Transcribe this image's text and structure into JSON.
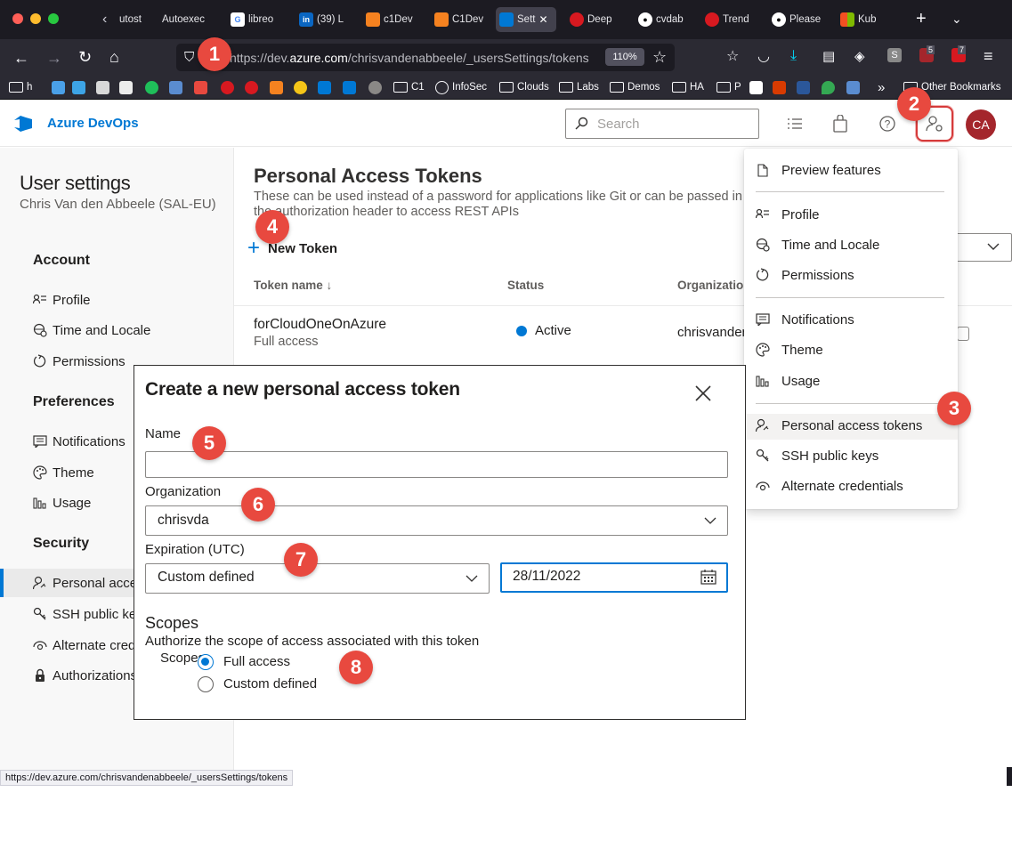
{
  "browser": {
    "tabs": [
      {
        "label": "utost"
      },
      {
        "label": "Autoexec"
      },
      {
        "label": "libreo"
      },
      {
        "label": "(39) L"
      },
      {
        "label": "c1Dev"
      },
      {
        "label": "C1Dev"
      },
      {
        "label": "Sett"
      },
      {
        "label": "Deep"
      },
      {
        "label": "cvdab"
      },
      {
        "label": "Trend"
      },
      {
        "label": "Please"
      },
      {
        "label": "Kub"
      }
    ],
    "url_prefix": "https://dev.",
    "url_domain": "azure.com",
    "url_path": "/chrisvandenabbeele/_usersSettings/tokens",
    "zoom": "110%",
    "bookmarks": [
      {
        "label": "h"
      },
      {
        "label": "C1"
      },
      {
        "label": "InfoSec"
      },
      {
        "label": "Clouds"
      },
      {
        "label": "Labs"
      },
      {
        "label": "Demos"
      },
      {
        "label": "HA"
      },
      {
        "label": "P"
      },
      {
        "label": "Other Bookmarks"
      }
    ],
    "badge_counts": [
      "5",
      "7"
    ],
    "status_url": "https://dev.azure.com/chrisvandenabbeele/_usersSettings/tokens"
  },
  "header": {
    "brand": "Azure DevOps",
    "search_placeholder": "Search",
    "avatar_initials": "CA"
  },
  "sidebar": {
    "title": "User settings",
    "subtitle": "Chris Van den Abbeele (SAL-EU)",
    "sections": {
      "account": "Account",
      "preferences": "Preferences",
      "security": "Security"
    },
    "items": {
      "profile": "Profile",
      "time_locale": "Time and Locale",
      "permissions": "Permissions",
      "notifications": "Notifications",
      "theme": "Theme",
      "usage": "Usage",
      "pat": "Personal access tokens",
      "ssh": "SSH public keys",
      "alternate": "Alternate credentials",
      "authorizations": "Authorizations"
    }
  },
  "main": {
    "title": "Personal Access Tokens",
    "description": "These can be used instead of a password for applications like Git or can be passed in the authorization header to access REST APIs",
    "new_token": "New Token",
    "columns": {
      "name": "Token name",
      "status": "Status",
      "org": "Organization"
    },
    "rows": [
      {
        "name": "forCloudOneOnAzure",
        "scope": "Full access",
        "status": "Active",
        "org": "chrisvandenabbeele"
      }
    ]
  },
  "menu": {
    "preview": "Preview features",
    "profile": "Profile",
    "time_locale": "Time and Locale",
    "permissions": "Permissions",
    "notifications": "Notifications",
    "theme": "Theme",
    "usage": "Usage",
    "pat": "Personal access tokens",
    "ssh": "SSH public keys",
    "alternate": "Alternate credentials"
  },
  "modal": {
    "title": "Create a new personal access token",
    "name_label": "Name",
    "name_value": "",
    "org_label": "Organization",
    "org_value": "chrisvda",
    "exp_label": "Expiration (UTC)",
    "exp_value": "Custom defined",
    "date_value": "28/11/2022",
    "scopes_heading": "Scopes",
    "scopes_desc": "Authorize the scope of access associated with this token",
    "scopes_label": "Scopes",
    "scope_full": "Full access",
    "scope_custom": "Custom defined",
    "scope_selected": "Full access"
  },
  "annotations": [
    "1",
    "2",
    "3",
    "4",
    "5",
    "6",
    "7",
    "8"
  ],
  "colors": {
    "accent": "#0078d4",
    "annotation": "#e8493f",
    "avatar": "#a4262c"
  }
}
